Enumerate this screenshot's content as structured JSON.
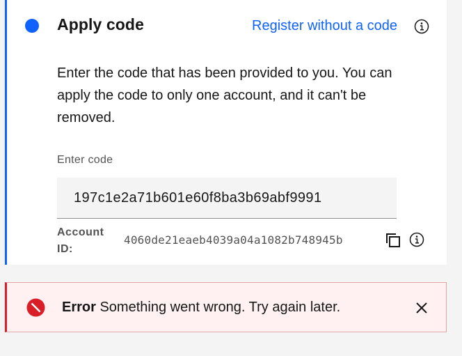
{
  "step": {
    "title": "Apply code",
    "register_link": "Register without a code",
    "description": "Enter the code that has been provided to you. You can apply the code to only one account, and it can't be removed."
  },
  "code_field": {
    "label": "Enter code",
    "value": "197c1e2a71b601e60f8ba3b69abf9991"
  },
  "account": {
    "label": "Account ID:",
    "id": "4060de21eaeb4039a04a1082b748945b"
  },
  "notification": {
    "kind": "error",
    "title": "Error",
    "message": "Something went wrong. Try again later."
  },
  "colors": {
    "accent": "#0f62fe",
    "error": "#da1e28",
    "error_bg": "#fff1f1"
  },
  "icons": {
    "step_marker": "filled-circle-icon",
    "register_info": "information-icon",
    "account_info": "information-icon",
    "copy": "copy-icon",
    "error": "error-filled-icon",
    "close": "close-icon"
  }
}
